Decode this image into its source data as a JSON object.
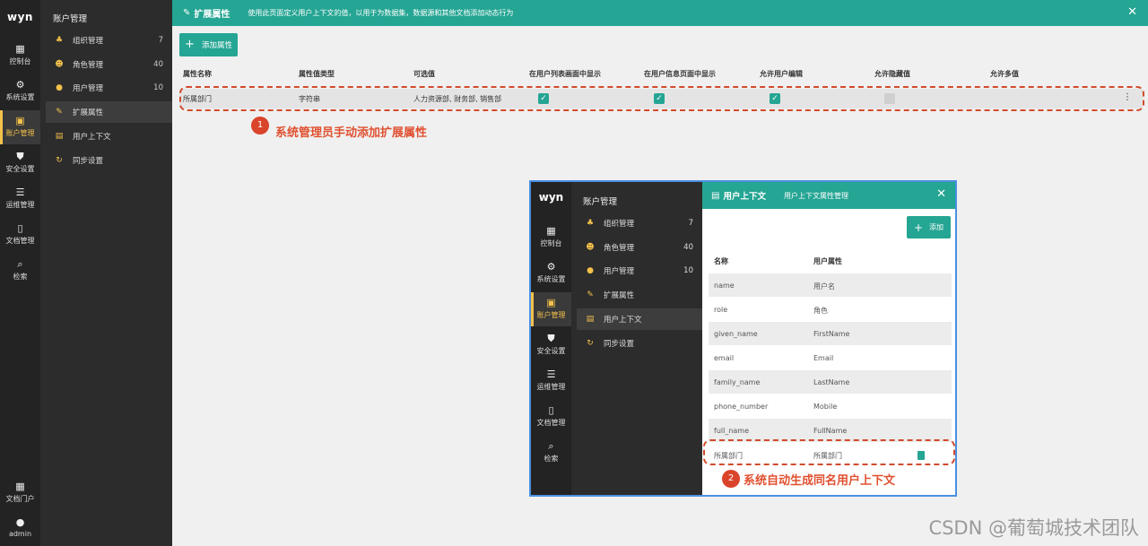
{
  "rail": {
    "logo": "wyn",
    "items": [
      {
        "label": "控制台",
        "icon": "dashboard-icon"
      },
      {
        "label": "系统设置",
        "icon": "gear-icon"
      },
      {
        "label": "账户管理",
        "icon": "account-icon"
      },
      {
        "label": "安全设置",
        "icon": "shield-icon"
      },
      {
        "label": "运维管理",
        "icon": "sliders-icon"
      },
      {
        "label": "文档管理",
        "icon": "document-icon"
      },
      {
        "label": "检索",
        "icon": "search-icon"
      }
    ],
    "bottom": [
      {
        "label": "文档门户",
        "icon": "grid-icon"
      },
      {
        "label": "admin",
        "icon": "user-icon"
      }
    ]
  },
  "subnav": {
    "title": "账户管理",
    "items": [
      {
        "label": "组织管理",
        "count": "7"
      },
      {
        "label": "角色管理",
        "count": "40"
      },
      {
        "label": "用户管理",
        "count": "10"
      },
      {
        "label": "扩展属性",
        "count": ""
      },
      {
        "label": "用户上下文",
        "count": ""
      },
      {
        "label": "同步设置",
        "count": ""
      }
    ]
  },
  "header": {
    "title": "扩展属性",
    "description": "使用此页面定义用户上下文的值，以用于为数据集，数据源和其他文档添加动态行为",
    "close": "✕"
  },
  "toolbar": {
    "add_label": "添加属性"
  },
  "table": {
    "columns": [
      "属性名称",
      "属性值类型",
      "可选值",
      "在用户列表画面中显示",
      "在用户信息页面中显示",
      "允许用户编辑",
      "允许隐藏值",
      "允许多值"
    ],
    "rows": [
      {
        "name": "所属部门",
        "type": "字符串",
        "options": "人力资源部, 财务部, 销售部",
        "show_list": true,
        "show_info": true,
        "editable": true,
        "hidden": false,
        "multi": false
      }
    ]
  },
  "annotation1": {
    "number": "1",
    "text": "系统管理员手动添加扩展属性"
  },
  "inset": {
    "logo": "wyn",
    "rail_items": [
      "控制台",
      "系统设置",
      "账户管理",
      "安全设置",
      "运维管理",
      "文档管理",
      "检索"
    ],
    "subnav_title": "账户管理",
    "subnav_items": [
      {
        "label": "组织管理",
        "count": "7"
      },
      {
        "label": "角色管理",
        "count": "40"
      },
      {
        "label": "用户管理",
        "count": "10"
      },
      {
        "label": "扩展属性",
        "count": ""
      },
      {
        "label": "用户上下文",
        "count": ""
      },
      {
        "label": "同步设置",
        "count": ""
      }
    ],
    "header_title": "用户上下文",
    "header_desc": "用户上下文属性管理",
    "close": "✕",
    "add_label": "添加",
    "col_name": "名称",
    "col_attr": "用户属性",
    "rows": [
      {
        "name": "name",
        "attr": "用户名"
      },
      {
        "name": "role",
        "attr": "角色"
      },
      {
        "name": "given_name",
        "attr": "FirstName"
      },
      {
        "name": "email",
        "attr": "Email"
      },
      {
        "name": "family_name",
        "attr": "LastName"
      },
      {
        "name": "phone_number",
        "attr": "Mobile"
      },
      {
        "name": "full_name",
        "attr": "FullName"
      },
      {
        "name": "所属部门",
        "attr": "所属部门"
      }
    ]
  },
  "annotation2": {
    "number": "2",
    "text": "系统自动生成同名用户上下文"
  },
  "watermark": "CSDN @葡萄城技术团队",
  "colors": {
    "accent": "#25a593",
    "highlight": "#f3c14b",
    "annotation": "#d24a2c"
  }
}
